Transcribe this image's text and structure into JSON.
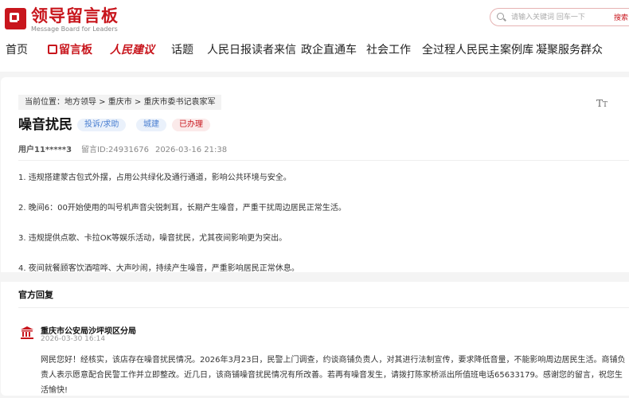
{
  "header": {
    "logo_cn": "领导留言板",
    "logo_en": "Message Board for Leaders",
    "search_placeholder": "请输入关键词 回车一下",
    "search_button": "搜索"
  },
  "nav": {
    "items": [
      "首页",
      "留言板",
      "人民建议",
      "话题",
      "人民日报读者来信",
      "政企直通车",
      "社会工作",
      "全过程人民民主案例库",
      "凝聚服务群众"
    ]
  },
  "breadcrumb": {
    "prefix": "当前位置：",
    "path": "地方领导 > 重庆市 > 重庆市委书记袁家军"
  },
  "message": {
    "title": "噪音扰民",
    "tags": [
      "投诉/求助",
      "城建",
      "已办理"
    ],
    "user": "用户11*****3",
    "id_label": "留言ID:24931676",
    "datetime": "2026-03-16 21:38",
    "paragraphs": [
      "1. 违规搭建蒙古包式外摆，占用公共绿化及通行通道，影响公共环境与安全。",
      "2. 晚间6：00开始使用的叫号机声音尖锐刺耳，长期产生噪音，严重干扰周边居民正常生活。",
      "3. 违规提供点歌、卡拉OK等娱乐活动，噪音扰民，尤其夜间影响更为突出。",
      "4. 夜间就餐顾客饮酒喧哗、大声吵闹，持续产生噪音，严重影响居民正常休息。"
    ]
  },
  "reply": {
    "section_title": "官方回复",
    "org": "重庆市公安局沙坪坝区分局",
    "date": "2026-03-30 16:14",
    "text": "网民您好！经核实，该店存在噪音扰民情况。2026年3月23日，民警上门调查，约谈商铺负责人，对其进行法制宣传，要求降低音量，不能影响周边居民生活。商铺负责人表示愿意配合民警工作并立即整改。近几日，该商铺噪音扰民情况有所改善。若再有噪音发生，请拨打陈家桥派出所值班电话65633179。感谢您的留言，祝您生活愉快!"
  },
  "colors": {
    "brand": "#c8161d",
    "tag_blue": "#4a7fd1"
  }
}
